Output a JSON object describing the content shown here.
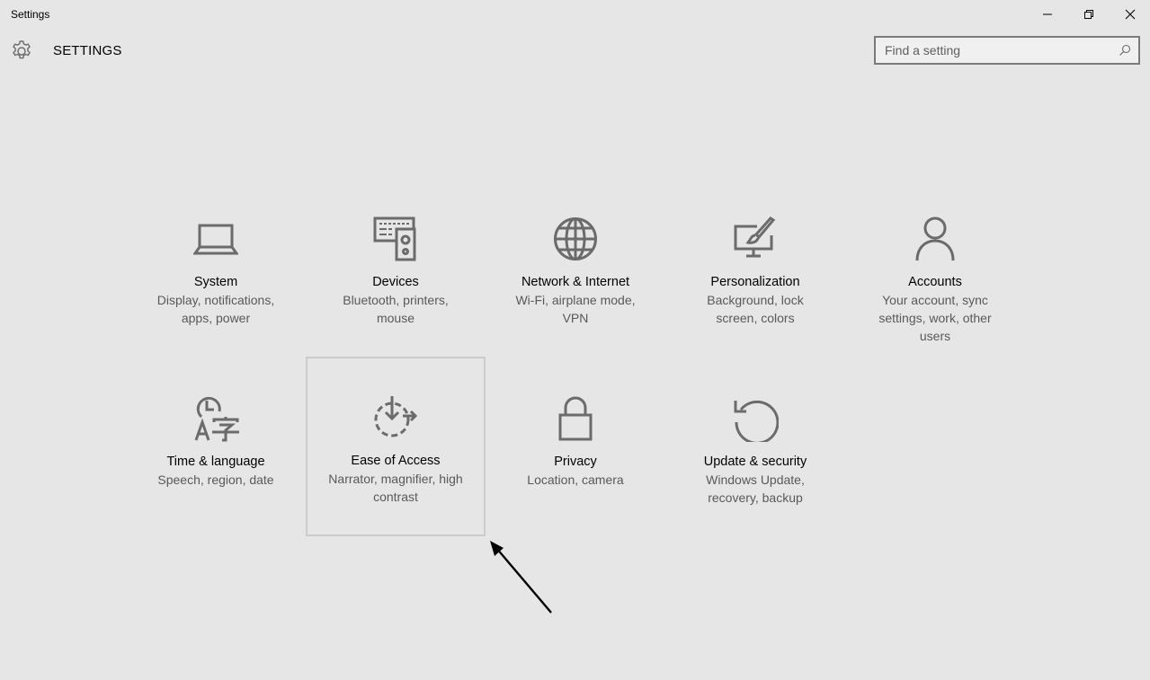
{
  "window": {
    "title": "Settings",
    "controls": {
      "minimize": "minimize",
      "restore": "restore",
      "close": "close"
    }
  },
  "header": {
    "title": "SETTINGS",
    "icon": "gear-icon"
  },
  "search": {
    "placeholder": "Find a setting",
    "value": "",
    "icon": "search-icon"
  },
  "tiles": [
    {
      "id": "system",
      "title": "System",
      "description": "Display, notifications, apps, power",
      "icon": "laptop-icon",
      "selected": false
    },
    {
      "id": "devices",
      "title": "Devices",
      "description": "Bluetooth, printers, mouse",
      "icon": "devices-icon",
      "selected": false
    },
    {
      "id": "network",
      "title": "Network & Internet",
      "description": "Wi-Fi, airplane mode, VPN",
      "icon": "globe-icon",
      "selected": false
    },
    {
      "id": "personalization",
      "title": "Personalization",
      "description": "Background, lock screen, colors",
      "icon": "paintbrush-monitor-icon",
      "selected": false
    },
    {
      "id": "accounts",
      "title": "Accounts",
      "description": "Your account, sync settings, work, other users",
      "icon": "person-icon",
      "selected": false
    },
    {
      "id": "time-language",
      "title": "Time & language",
      "description": "Speech, region, date",
      "icon": "time-language-icon",
      "selected": false
    },
    {
      "id": "ease-of-access",
      "title": "Ease of Access",
      "description": "Narrator, magnifier, high contrast",
      "icon": "ease-of-access-icon",
      "selected": true
    },
    {
      "id": "privacy",
      "title": "Privacy",
      "description": "Location, camera",
      "icon": "lock-icon",
      "selected": false
    },
    {
      "id": "update-security",
      "title": "Update & security",
      "description": "Windows Update, recovery, backup",
      "icon": "refresh-icon",
      "selected": false
    }
  ],
  "colors": {
    "background": "#e6e6e6",
    "icon": "#6b6b6b",
    "description_text": "#595959",
    "selection_border": "#cbcbcb"
  }
}
